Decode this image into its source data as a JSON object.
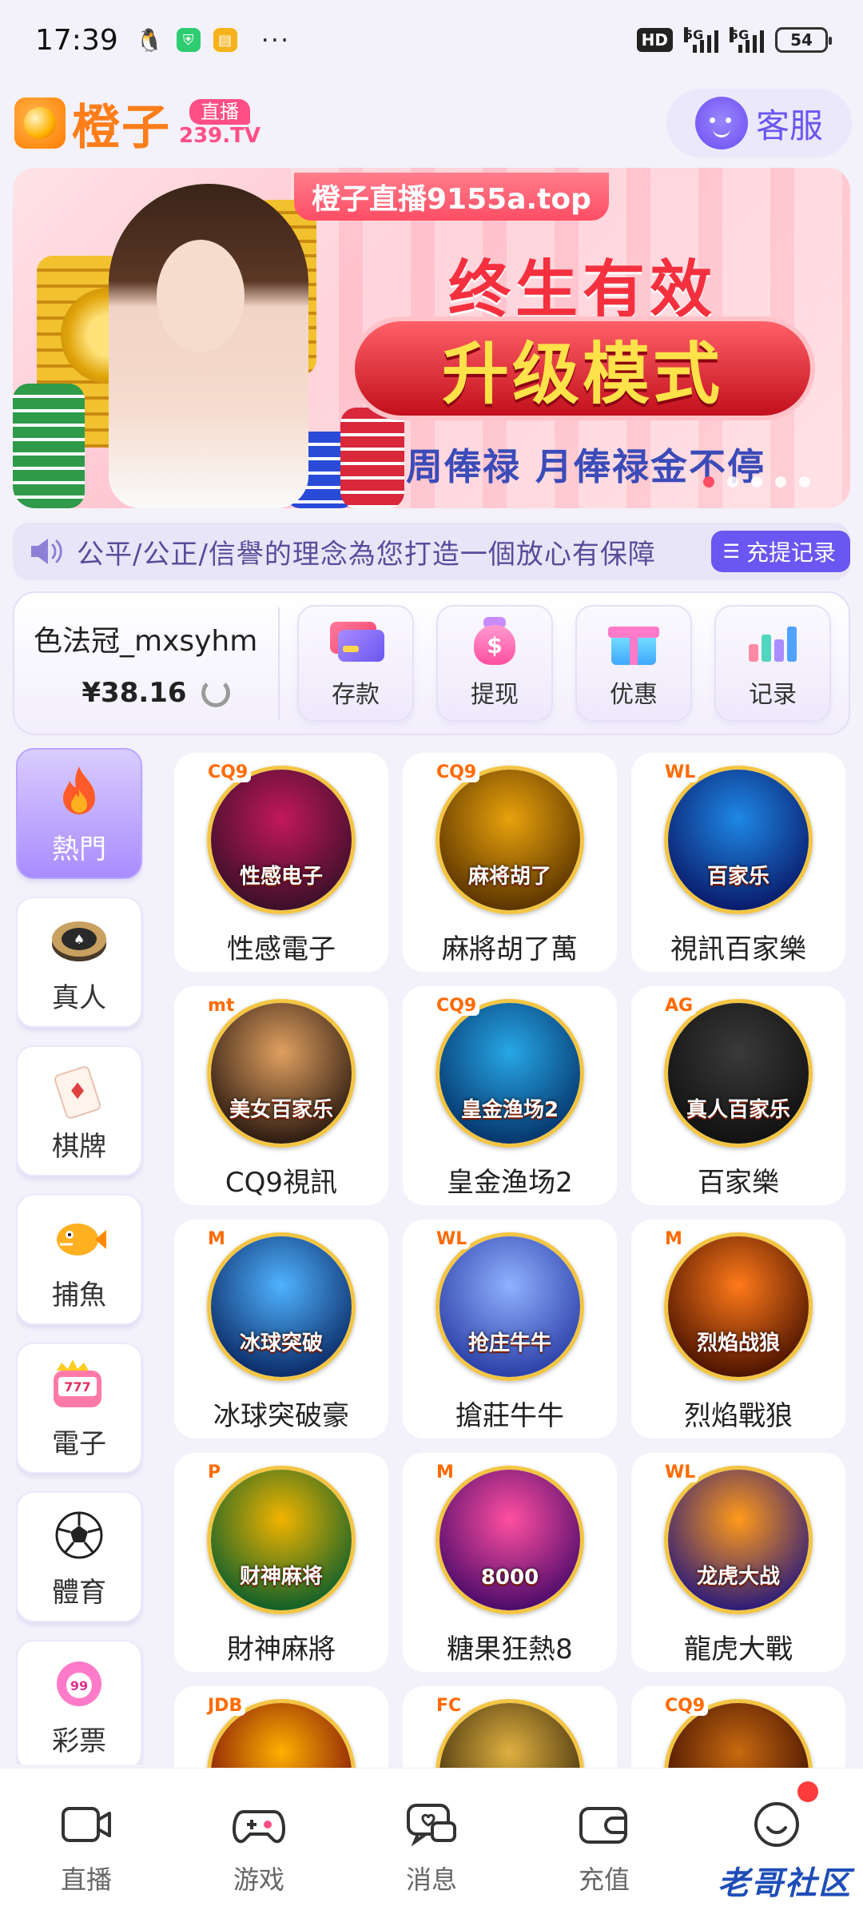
{
  "status_bar": {
    "time": "17:39",
    "network_label": "5G",
    "network_label_2": "5G",
    "battery": "54",
    "hd_label": "HD"
  },
  "header": {
    "logo_text": "橙子",
    "logo_badge": "直播",
    "logo_domain": "239.TV",
    "cs_label": "客服"
  },
  "banner": {
    "site_label": "橙子直播9155a.top",
    "line1": "终生有效",
    "line2": "升级模式",
    "line3": "周俸禄  月俸禄金不停",
    "slide_count": 5,
    "active_slide": 0
  },
  "marquee": {
    "text": "公平/公正/信譽的理念為您打造一個放心有保障",
    "button_label": "充提记录"
  },
  "wallet": {
    "username": "色法冠_mxsyhm",
    "balance": "¥38.16",
    "actions": [
      {
        "label": "存款",
        "icon": "deposit-card-icon"
      },
      {
        "label": "提现",
        "icon": "withdraw-bag-icon"
      },
      {
        "label": "优惠",
        "icon": "gift-icon"
      },
      {
        "label": "记录",
        "icon": "bar-chart-icon"
      }
    ]
  },
  "categories": [
    {
      "label": "熱門",
      "icon": "flame-icon",
      "active": true
    },
    {
      "label": "真人",
      "icon": "casino-chip-icon",
      "active": false
    },
    {
      "label": "棋牌",
      "icon": "playing-card-icon",
      "active": false
    },
    {
      "label": "捕魚",
      "icon": "fish-icon",
      "active": false
    },
    {
      "label": "電子",
      "icon": "slot-machine-icon",
      "active": false
    },
    {
      "label": "體育",
      "icon": "soccer-ball-icon",
      "active": false
    },
    {
      "label": "彩票",
      "icon": "lottery-ball-icon",
      "active": false
    }
  ],
  "games": [
    {
      "name": "性感電子",
      "provider": "CQ9",
      "art_title": "性感电子",
      "colors": [
        "#3a0f2a",
        "#c2185b"
      ]
    },
    {
      "name": "麻將胡了萬",
      "provider": "CQ9",
      "art_title": "麻将胡了",
      "colors": [
        "#5a3300",
        "#e8a20c"
      ]
    },
    {
      "name": "視訊百家樂",
      "provider": "WL",
      "art_title": "百家乐",
      "colors": [
        "#0a1a6a",
        "#1e88e5"
      ]
    },
    {
      "name": "CQ9視訊",
      "provider": "mt",
      "art_title": "美女百家乐",
      "colors": [
        "#2c1a10",
        "#e0a060"
      ]
    },
    {
      "name": "皇金渔场2",
      "provider": "CQ9",
      "art_title": "皇金渔场2",
      "colors": [
        "#05356b",
        "#27a7e6"
      ]
    },
    {
      "name": "百家樂",
      "provider": "AG",
      "art_title": "真人百家乐",
      "colors": [
        "#111111",
        "#3a3a3a"
      ]
    },
    {
      "name": "冰球突破豪",
      "provider": "M",
      "art_title": "冰球突破",
      "colors": [
        "#0b2a66",
        "#4fb3ff"
      ]
    },
    {
      "name": "搶莊牛牛",
      "provider": "WL",
      "art_title": "抢庄牛牛",
      "colors": [
        "#2b3fa6",
        "#8fb0ff"
      ]
    },
    {
      "name": "烈焰戰狼",
      "provider": "M",
      "art_title": "烈焰战狼",
      "colors": [
        "#4a1200",
        "#ff7a1a"
      ]
    },
    {
      "name": "財神麻將",
      "provider": "P",
      "art_title": "财神麻将",
      "colors": [
        "#0d5f2a",
        "#f2b400"
      ]
    },
    {
      "name": "糖果狂熱8",
      "provider": "M",
      "art_title": "8000",
      "colors": [
        "#4a0a6a",
        "#ff4fa0"
      ]
    },
    {
      "name": "龍虎大戰",
      "provider": "WL",
      "art_title": "龙虎大战",
      "colors": [
        "#2a1a7a",
        "#ff9a1a"
      ]
    },
    {
      "name": "",
      "provider": "JDB",
      "art_title": "",
      "colors": [
        "#7a0a0a",
        "#ffb000"
      ]
    },
    {
      "name": "",
      "provider": "FC",
      "art_title": "",
      "colors": [
        "#3a2a0a",
        "#e0b040"
      ]
    },
    {
      "name": "",
      "provider": "CQ9",
      "art_title": "",
      "colors": [
        "#3a0a00",
        "#c86a10"
      ]
    }
  ],
  "tabs": [
    {
      "label": "直播",
      "icon": "video-camera-icon"
    },
    {
      "label": "游戏",
      "icon": "gamepad-icon"
    },
    {
      "label": "消息",
      "icon": "message-icon"
    },
    {
      "label": "充值",
      "icon": "wallet-icon"
    },
    {
      "label": "",
      "icon": "smiley-profile-icon"
    }
  ],
  "watermark": "老哥社区",
  "colors": {
    "accent": "#6a56f0",
    "brand_orange": "#ff7e1a",
    "badge_pink": "#ff4f86",
    "notification": "#ff3b3b"
  }
}
